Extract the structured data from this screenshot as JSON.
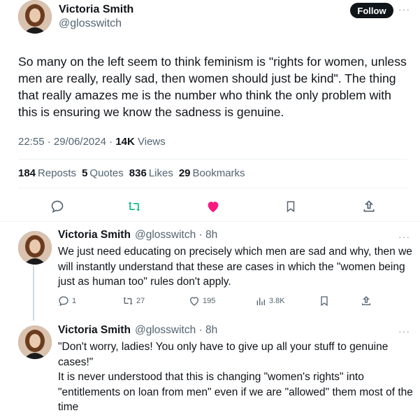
{
  "main": {
    "author_name": "Victoria Smith",
    "author_handle": "@glosswitch",
    "follow_label": "Follow",
    "more_label": "···",
    "text": "So many on the left seem to think feminism is \"rights for women, unless men are really, really sad, then women should just be kind\". The thing that really amazes me is the number who think the only problem with this is ensuring we know the sadness is genuine.",
    "time": "22:55",
    "date": "29/06/2024",
    "views_count": "14K",
    "views_label": "Views",
    "stats": {
      "reposts_n": "184",
      "reposts_label": "Reposts",
      "quotes_n": "5",
      "quotes_label": "Quotes",
      "likes_n": "836",
      "likes_label": "Likes",
      "bookmarks_n": "29",
      "bookmarks_label": "Bookmarks"
    },
    "colors": {
      "repost": "#00ba7c",
      "like": "#f91880",
      "icon": "#536471"
    }
  },
  "replies": [
    {
      "author_name": "Victoria Smith",
      "author_handle": "@glosswitch",
      "age": "8h",
      "text": "We just need educating on precisely which men are sad and why, then we will instantly understand that these are cases in which the \"women being just as human too\" rules don't apply.",
      "replies": "1",
      "reposts": "27",
      "likes": "195",
      "views": "3.8K"
    },
    {
      "author_name": "Victoria Smith",
      "author_handle": "@glosswitch",
      "age": "8h",
      "text_line1": "\"Don't worry, ladies! You only have to give up all your stuff to genuine cases!\"",
      "text_line2": "It is never understood that this is changing \"women's rights\" into \"entitlements on loan from men\" even if we are \"allowed\" them most of the time"
    }
  ]
}
